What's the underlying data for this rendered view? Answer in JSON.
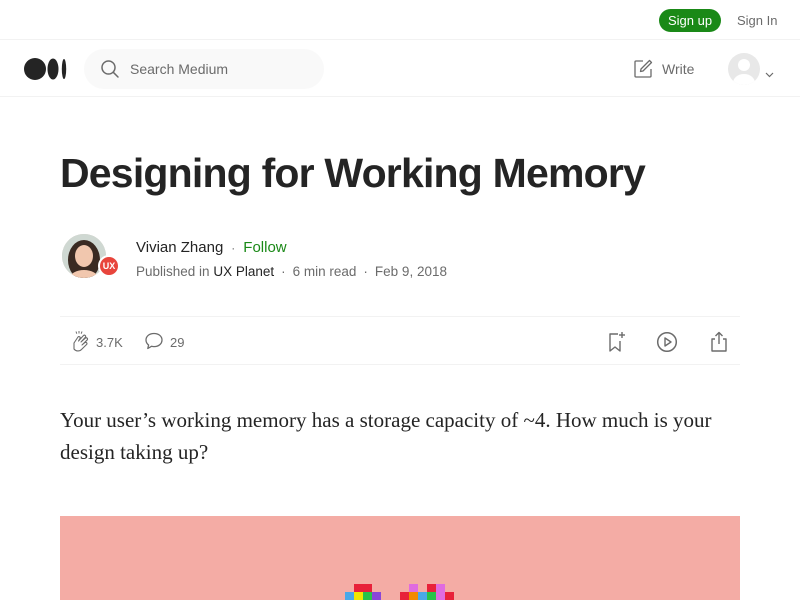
{
  "topbar": {
    "signup_label": "Sign up",
    "signin_label": "Sign In"
  },
  "header": {
    "search_placeholder": "Search Medium",
    "write_label": "Write",
    "logo_icon": "medium-logo-icon",
    "search_icon": "search-icon",
    "write_icon": "pencil-square-icon",
    "avatar_icon": "user-avatar-icon",
    "chevron_icon": "chevron-down-icon"
  },
  "article": {
    "title": "Designing for Working Memory",
    "author": {
      "name": "Vivian Zhang",
      "follow_label": "Follow",
      "published_prefix": "Published in",
      "publication": "UX Planet",
      "publication_badge": "UX",
      "read_time": "6 min read",
      "date": "Feb 9, 2018",
      "dot": "·"
    },
    "actions": {
      "claps": "3.7K",
      "comments": "29",
      "clap_icon": "clap-icon",
      "comment_icon": "comment-icon",
      "bookmark_icon": "bookmark-add-icon",
      "listen_icon": "play-circle-icon",
      "share_icon": "share-icon"
    },
    "subtitle": "Your user’s working memory has a storage capacity of ~4. How much is your design taking up?",
    "hero_image": {
      "background_color": "#f4aca5"
    }
  },
  "colors": {
    "accent": "#1a8917",
    "text": "#242424",
    "muted": "#6b6b6b",
    "badge": "#e8453c"
  }
}
